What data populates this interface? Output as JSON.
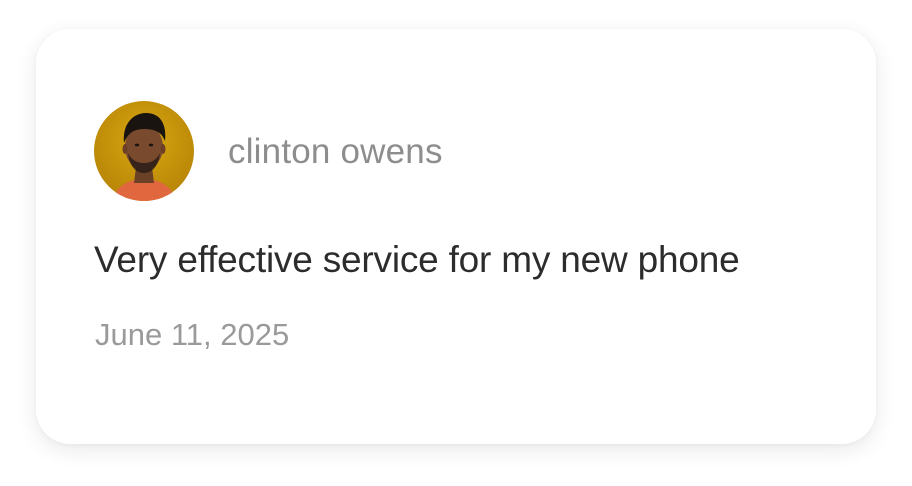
{
  "review": {
    "author": {
      "name": "clinton owens",
      "avatar_icon": "user-avatar-photo"
    },
    "text": "Very effective service for my new phone",
    "date": "June 11, 2025"
  },
  "colors": {
    "card_background": "#ffffff",
    "author_name": "#8d8d8d",
    "review_text": "#2c2c2c",
    "date_text": "#9a9a9a",
    "avatar_background": "#c8960c"
  }
}
